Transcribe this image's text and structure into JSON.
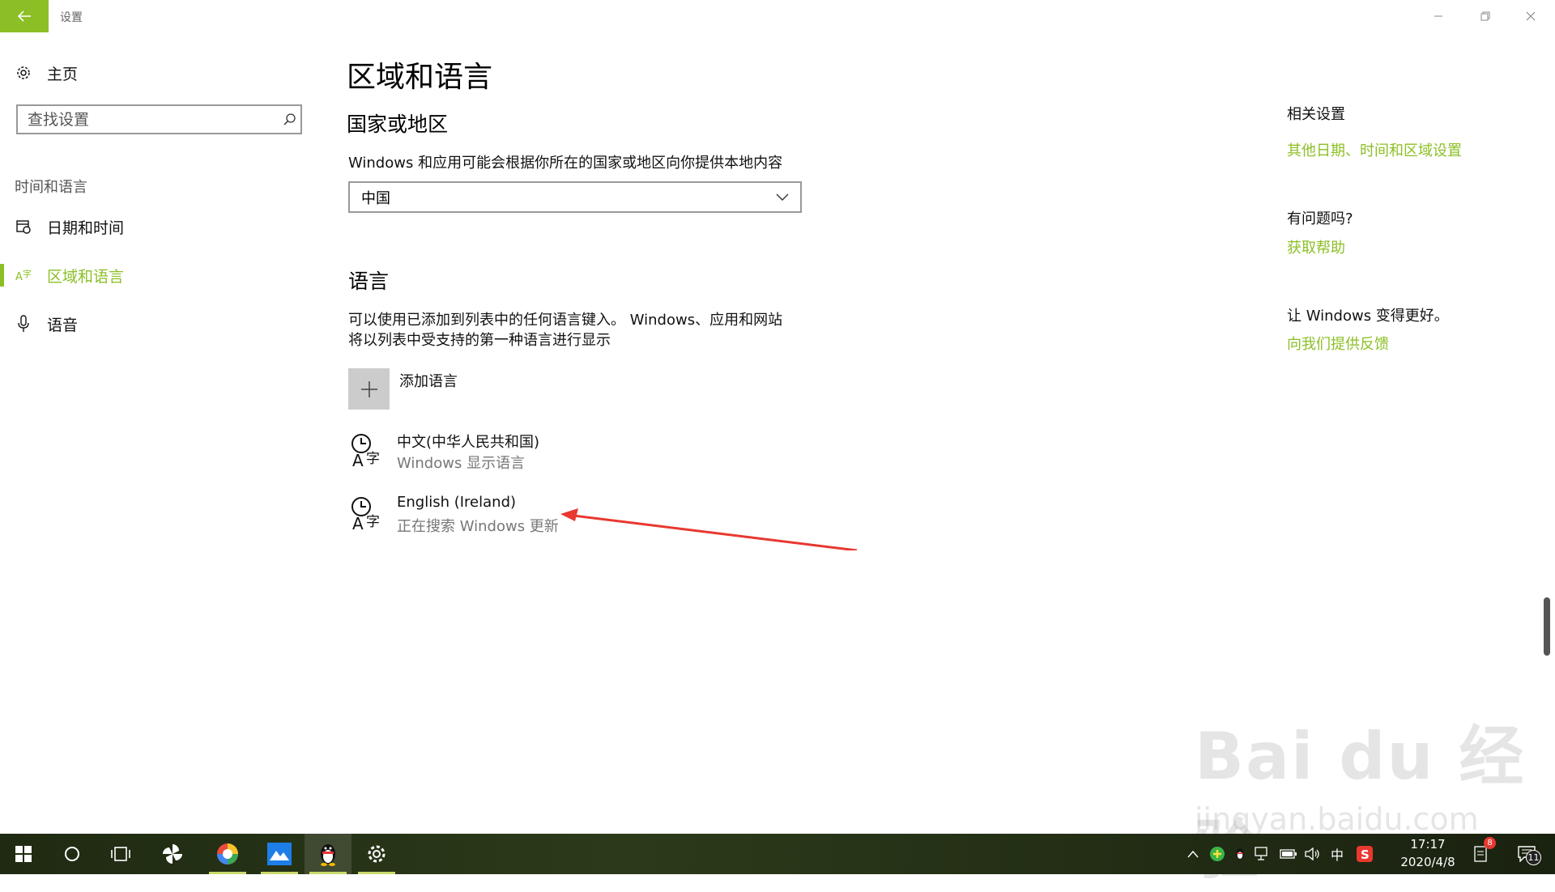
{
  "window": {
    "title": "设置",
    "back_icon": "arrow-left-icon",
    "minimize_icon": "minimize-icon",
    "restore_icon": "restore-icon",
    "close_icon": "close-icon"
  },
  "sidebar": {
    "home_label": "主页",
    "search_placeholder": "查找设置",
    "section_label": "时间和语言",
    "items": [
      {
        "label": "日期和时间",
        "icon": "calendar-clock-icon"
      },
      {
        "label": "区域和语言",
        "icon": "language-icon"
      },
      {
        "label": "语音",
        "icon": "microphone-icon"
      }
    ]
  },
  "main": {
    "title": "区域和语言",
    "region": {
      "heading": "国家或地区",
      "description": "Windows 和应用可能会根据你所在的国家或地区向你提供本地内容",
      "selected": "中国"
    },
    "language": {
      "heading": "语言",
      "description_line1": "可以使用已添加到列表中的任何语言键入。 Windows、应用和网站",
      "description_line2": "将以列表中受支持的第一种语言进行显示",
      "add_label": "添加语言",
      "items": [
        {
          "name": "中文(中华人民共和国)",
          "status": "Windows 显示语言"
        },
        {
          "name": "English (Ireland)",
          "status": "正在搜索 Windows 更新"
        }
      ]
    }
  },
  "related": {
    "heading": "相关设置",
    "link": "其他日期、时间和区域设置",
    "help_heading": "有问题吗?",
    "help_link": "获取帮助",
    "feedback_heading": "让 Windows 变得更好。",
    "feedback_link": "向我们提供反馈"
  },
  "watermark": {
    "brand": "Bai du 经验",
    "url": "jingyan.baidu.com"
  },
  "taskbar": {
    "clock_time": "17:17",
    "clock_date": "2020/4/8",
    "ime": "中",
    "notification_count": "8",
    "action_center_count": "11"
  },
  "colors": {
    "accent": "#8cbf26",
    "arrow": "#e8382f"
  }
}
